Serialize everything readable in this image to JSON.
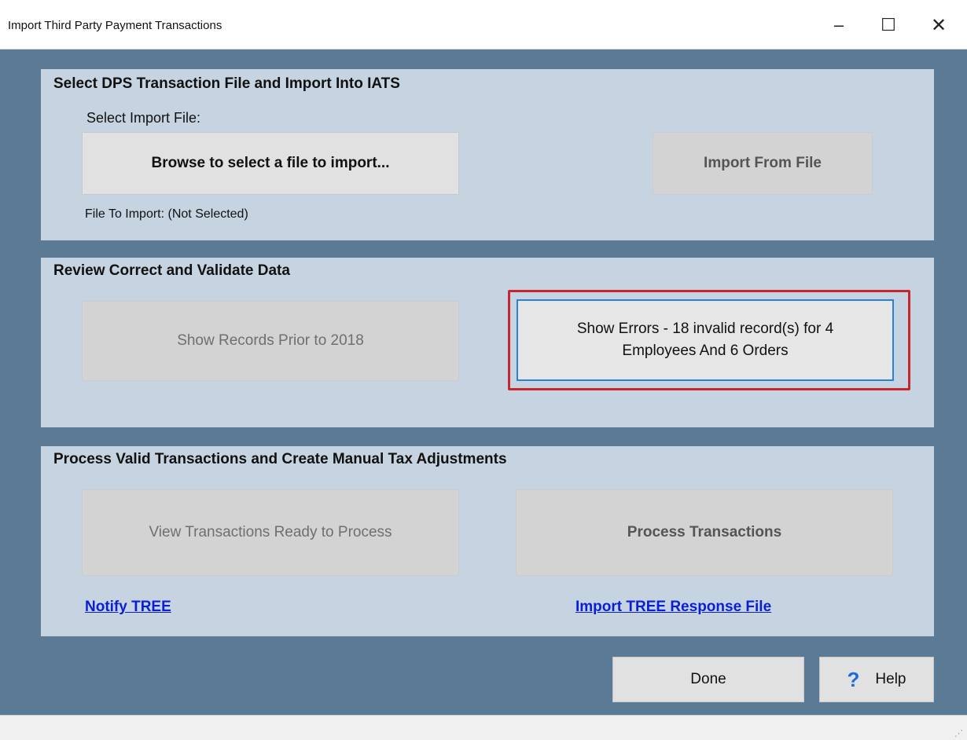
{
  "window": {
    "title": "Import Third Party Payment Transactions",
    "minimize_glyph": "–",
    "maximize_glyph": "☐",
    "close_glyph": "✕"
  },
  "section_import": {
    "title": "Select DPS Transaction File and Import Into IATS",
    "select_label": "Select Import File:",
    "browse_label": "Browse to select a file to import...",
    "import_from_file_label": "Import From File",
    "file_to_import_label": "File To Import: (Not Selected)"
  },
  "section_review": {
    "title": "Review Correct and Validate Data",
    "show_records_label": "Show Records Prior to 2018",
    "show_errors_line1": "Show Errors - 18 invalid record(s) for 4",
    "show_errors_line2": "Employees And 6 Orders"
  },
  "section_process": {
    "title": "Process Valid Transactions and Create Manual Tax Adjustments",
    "view_ready_label": "View Transactions Ready to Process",
    "process_label": "Process Transactions",
    "notify_link": "Notify TREE",
    "import_response_link": "Import TREE Response File"
  },
  "footer": {
    "done_label": "Done",
    "help_label": "Help",
    "help_icon_glyph": "?"
  },
  "colors": {
    "background": "#5a7a96",
    "panel": "#c6d4e2",
    "highlight": "#c8262e",
    "focus_border": "#2a7fd6",
    "link": "#0a1fd4"
  }
}
